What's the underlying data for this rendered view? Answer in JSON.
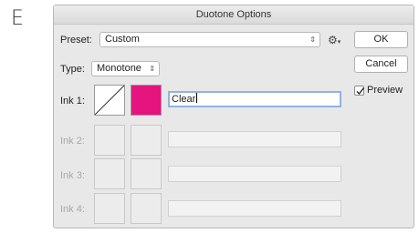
{
  "step_letter": "E",
  "dialog": {
    "title": "Duotone Options",
    "preset": {
      "label": "Preset:",
      "value": "Custom"
    },
    "type": {
      "label": "Type:",
      "value": "Monotone"
    },
    "buttons": {
      "ok": "OK",
      "cancel": "Cancel"
    },
    "preview": {
      "label": "Preview",
      "checked": true
    },
    "inks": [
      {
        "label": "Ink 1:",
        "color": "#e5147f",
        "name": "Clear",
        "enabled": true
      },
      {
        "label": "Ink 2:",
        "color": "",
        "name": "",
        "enabled": false
      },
      {
        "label": "Ink 3:",
        "color": "",
        "name": "",
        "enabled": false
      },
      {
        "label": "Ink 4:",
        "color": "",
        "name": "",
        "enabled": false
      }
    ]
  }
}
